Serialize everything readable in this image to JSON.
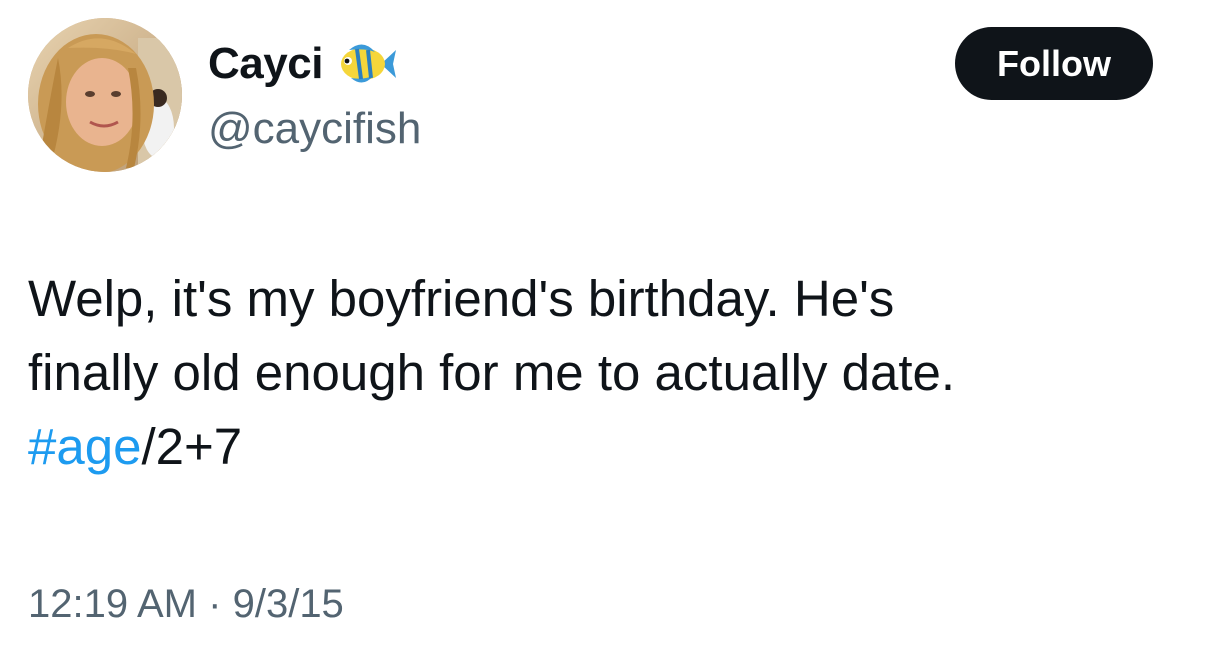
{
  "author": {
    "display_name": "Cayci",
    "name_emoji": "tropical-fish-icon",
    "handle": "@caycifish"
  },
  "follow_button": {
    "label": "Follow"
  },
  "tweet": {
    "line1": "Welp, it's my boyfriend's birthday. He's",
    "line2": "finally old enough for me to actually date.",
    "hashtag": "#age",
    "line3_rest": "/2+7"
  },
  "meta": {
    "time": "12:19 AM",
    "separator": "·",
    "date": "9/3/15"
  },
  "colors": {
    "text": "#0f1419",
    "secondary": "#536471",
    "link": "#1d9bf0",
    "button_bg": "#0f1419",
    "button_text": "#ffffff"
  }
}
